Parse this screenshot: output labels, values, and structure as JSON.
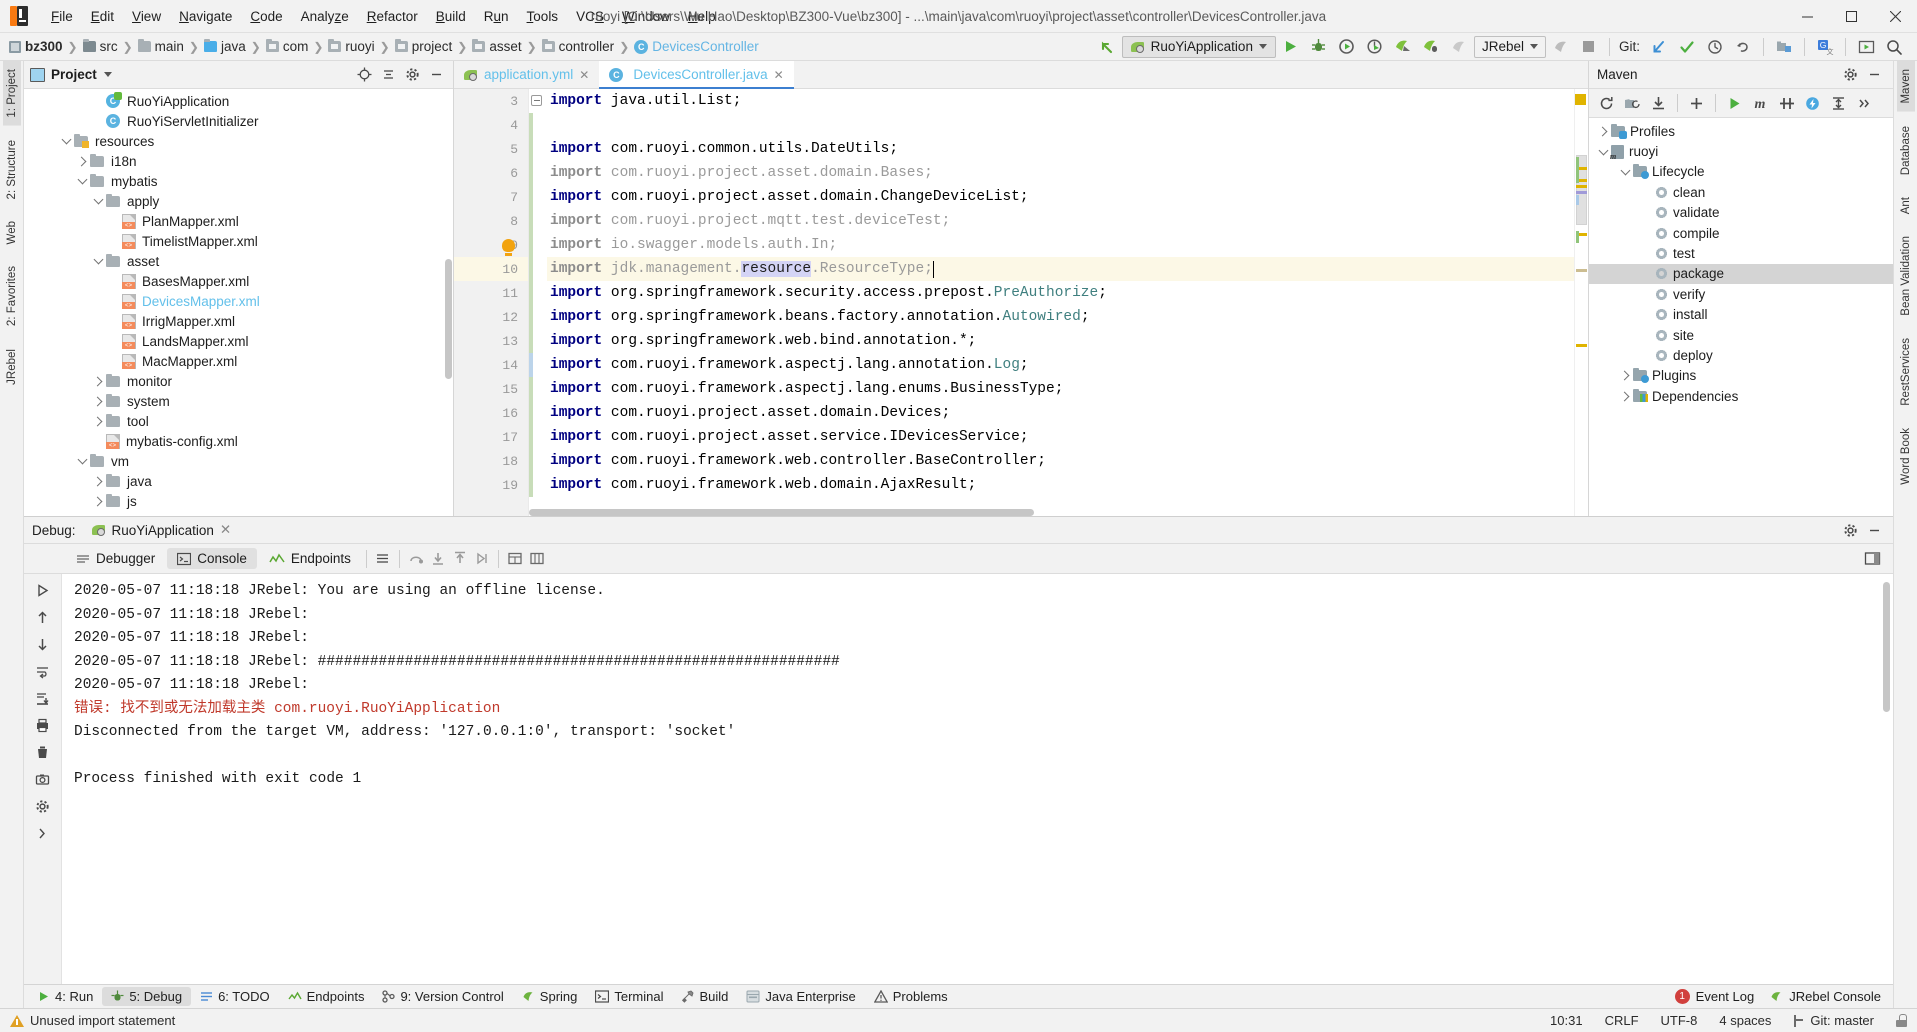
{
  "window": {
    "title": "ruoyi [C:\\Users\\Wu Hao\\Desktop\\BZ300-Vue\\bz300] - ...\\main\\java\\com\\ruoyi\\project\\asset\\controller\\DevicesController.java",
    "minimize": "─",
    "maximize": "☐",
    "close": "✕"
  },
  "menu": [
    "File",
    "Edit",
    "View",
    "Navigate",
    "Code",
    "Analyze",
    "Refactor",
    "Build",
    "Run",
    "Tools",
    "VCS",
    "Window",
    "Help"
  ],
  "breadcrumbs": [
    {
      "label": "bz300",
      "icon": "module-icon",
      "style": "bold"
    },
    {
      "label": "src",
      "icon": "folder-icon",
      "style": "normal"
    },
    {
      "label": "main",
      "icon": "folder-icon",
      "style": "normal"
    },
    {
      "label": "java",
      "icon": "source-folder-icon",
      "style": "normal"
    },
    {
      "label": "com",
      "icon": "package-icon",
      "style": "normal"
    },
    {
      "label": "ruoyi",
      "icon": "package-icon",
      "style": "normal"
    },
    {
      "label": "project",
      "icon": "package-icon",
      "style": "normal"
    },
    {
      "label": "asset",
      "icon": "package-icon",
      "style": "normal"
    },
    {
      "label": "controller",
      "icon": "package-icon",
      "style": "normal"
    },
    {
      "label": "DevicesController",
      "icon": "class-icon",
      "style": "blue"
    }
  ],
  "toolbar": {
    "run_config": "RuoYiApplication",
    "jrebel_config": "JRebel",
    "git_label": "Git:",
    "buttons": [
      "run-button",
      "debug-button",
      "run-with-coverage-button",
      "profile-button",
      "jrebel-run-button",
      "jrebel-debug-button",
      "jrebel-run-disabled-button",
      "jrebel-extra-button",
      "stop-button"
    ],
    "git_buttons": [
      "update-project-button",
      "commit-button",
      "history-button",
      "rollback-button"
    ],
    "right_buttons": [
      "project-structure-button",
      "translate-button",
      "present-mode-button",
      "search-everywhere-button"
    ]
  },
  "project_panel": {
    "title": "Project",
    "header_buttons": [
      "locate-button",
      "collapse-all-button",
      "settings-button",
      "hide-button"
    ],
    "tree": [
      {
        "label": "RuoYiApplication",
        "indent": 5,
        "icon": "runnable-class-icon",
        "arrow": "none",
        "style": "normal"
      },
      {
        "label": "RuoYiServletInitializer",
        "indent": 5,
        "icon": "class-icon",
        "arrow": "none",
        "style": "normal"
      },
      {
        "label": "resources",
        "indent": 3,
        "icon": "resource-folder-icon",
        "arrow": "down",
        "style": "normal"
      },
      {
        "label": "i18n",
        "indent": 4,
        "icon": "folder-icon",
        "arrow": "right",
        "style": "normal"
      },
      {
        "label": "mybatis",
        "indent": 4,
        "icon": "folder-icon",
        "arrow": "down",
        "style": "normal"
      },
      {
        "label": "apply",
        "indent": 5,
        "icon": "folder-icon",
        "arrow": "down",
        "style": "normal"
      },
      {
        "label": "PlanMapper.xml",
        "indent": 6,
        "icon": "xml-file-icon",
        "arrow": "none",
        "style": "normal"
      },
      {
        "label": "TimelistMapper.xml",
        "indent": 6,
        "icon": "xml-file-icon",
        "arrow": "none",
        "style": "normal"
      },
      {
        "label": "asset",
        "indent": 5,
        "icon": "folder-icon",
        "arrow": "down",
        "style": "normal"
      },
      {
        "label": "BasesMapper.xml",
        "indent": 6,
        "icon": "xml-file-icon",
        "arrow": "none",
        "style": "normal"
      },
      {
        "label": "DevicesMapper.xml",
        "indent": 6,
        "icon": "xml-file-icon",
        "arrow": "none",
        "style": "blue"
      },
      {
        "label": "IrrigMapper.xml",
        "indent": 6,
        "icon": "xml-file-icon",
        "arrow": "none",
        "style": "normal"
      },
      {
        "label": "LandsMapper.xml",
        "indent": 6,
        "icon": "xml-file-icon",
        "arrow": "none",
        "style": "normal"
      },
      {
        "label": "MacMapper.xml",
        "indent": 6,
        "icon": "xml-file-icon",
        "arrow": "none",
        "style": "normal"
      },
      {
        "label": "monitor",
        "indent": 5,
        "icon": "folder-icon",
        "arrow": "right",
        "style": "normal"
      },
      {
        "label": "system",
        "indent": 5,
        "icon": "folder-icon",
        "arrow": "right",
        "style": "normal"
      },
      {
        "label": "tool",
        "indent": 5,
        "icon": "folder-icon",
        "arrow": "right",
        "style": "normal"
      },
      {
        "label": "mybatis-config.xml",
        "indent": 5,
        "icon": "xml-file-icon",
        "arrow": "none",
        "style": "normal"
      },
      {
        "label": "vm",
        "indent": 4,
        "icon": "folder-icon",
        "arrow": "down",
        "style": "normal"
      },
      {
        "label": "java",
        "indent": 5,
        "icon": "folder-icon",
        "arrow": "right",
        "style": "normal"
      },
      {
        "label": "js",
        "indent": 5,
        "icon": "folder-icon",
        "arrow": "right",
        "style": "normal"
      }
    ]
  },
  "editor": {
    "tabs": [
      {
        "label": "application.yml",
        "icon": "yml-file-icon",
        "active": false
      },
      {
        "label": "DevicesController.java",
        "icon": "class-icon",
        "active": true
      }
    ],
    "first_line_number": 3,
    "current_line": 10,
    "lines": [
      {
        "num": 3,
        "segments": [
          {
            "t": "import ",
            "c": "kw"
          },
          {
            "t": "java.util.List;",
            "c": "id"
          }
        ]
      },
      {
        "num": 4,
        "segments": []
      },
      {
        "num": 5,
        "segments": [
          {
            "t": "import ",
            "c": "kw"
          },
          {
            "t": "com.ruoyi.common.utils.DateUtils;",
            "c": "id"
          }
        ]
      },
      {
        "num": 6,
        "segments": [
          {
            "t": "import ",
            "c": "kwg"
          },
          {
            "t": "com.ruoyi.project.asset.domain.Bases;",
            "c": "dim"
          }
        ]
      },
      {
        "num": 7,
        "segments": [
          {
            "t": "import ",
            "c": "kw"
          },
          {
            "t": "com.ruoyi.project.asset.domain.ChangeDeviceList;",
            "c": "id"
          }
        ]
      },
      {
        "num": 8,
        "segments": [
          {
            "t": "import ",
            "c": "kwg"
          },
          {
            "t": "com.ruoyi.project.mqtt.test.deviceTest;",
            "c": "dim"
          }
        ]
      },
      {
        "num": 9,
        "segments": [
          {
            "t": "import ",
            "c": "kwg"
          },
          {
            "t": "io.swagger.models.auth.In;",
            "c": "dim"
          }
        ]
      },
      {
        "num": 10,
        "segments": [
          {
            "t": "import ",
            "c": "kwg"
          },
          {
            "t": "jdk.management.",
            "c": "dim"
          },
          {
            "t": "resource",
            "c": "sel"
          },
          {
            "t": ".ResourceType;",
            "c": "dim"
          }
        ]
      },
      {
        "num": 11,
        "segments": [
          {
            "t": "import ",
            "c": "kw"
          },
          {
            "t": "org.springframework.security.access.prepost.",
            "c": "id"
          },
          {
            "t": "PreAuthorize",
            "c": "cls"
          },
          {
            "t": ";",
            "c": "id"
          }
        ]
      },
      {
        "num": 12,
        "segments": [
          {
            "t": "import ",
            "c": "kw"
          },
          {
            "t": "org.springframework.beans.factory.annotation.",
            "c": "id"
          },
          {
            "t": "Autowired",
            "c": "cls"
          },
          {
            "t": ";",
            "c": "id"
          }
        ]
      },
      {
        "num": 13,
        "segments": [
          {
            "t": "import ",
            "c": "kw"
          },
          {
            "t": "org.springframework.web.bind.annotation.*;",
            "c": "id"
          }
        ]
      },
      {
        "num": 14,
        "segments": [
          {
            "t": "import ",
            "c": "kw"
          },
          {
            "t": "com.ruoyi.framework.aspectj.lang.annotation.",
            "c": "id"
          },
          {
            "t": "Log",
            "c": "cls"
          },
          {
            "t": ";",
            "c": "id"
          }
        ]
      },
      {
        "num": 15,
        "segments": [
          {
            "t": "import ",
            "c": "kw"
          },
          {
            "t": "com.ruoyi.framework.aspectj.lang.enums.BusinessType;",
            "c": "id"
          }
        ]
      },
      {
        "num": 16,
        "segments": [
          {
            "t": "import ",
            "c": "kw"
          },
          {
            "t": "com.ruoyi.project.asset.domain.Devices;",
            "c": "id"
          }
        ]
      },
      {
        "num": 17,
        "segments": [
          {
            "t": "import ",
            "c": "kw"
          },
          {
            "t": "com.ruoyi.project.asset.service.IDevicesService;",
            "c": "id"
          }
        ]
      },
      {
        "num": 18,
        "segments": [
          {
            "t": "import ",
            "c": "kw"
          },
          {
            "t": "com.ruoyi.framework.web.controller.BaseController;",
            "c": "id"
          }
        ]
      },
      {
        "num": 19,
        "segments": [
          {
            "t": "import ",
            "c": "kw"
          },
          {
            "t": "com.ruoyi.framework.web.domain.AjaxResult;",
            "c": "id"
          }
        ]
      }
    ]
  },
  "maven": {
    "title": "Maven",
    "toolbar_buttons": [
      "reload-all-button",
      "generate-sources-button",
      "download-sources-button",
      "add-maven-project-button",
      "run-maven-build-button",
      "execute-goal-button",
      "toggle-skip-tests-button",
      "toggle-offline-button",
      "expand-all-button",
      "more-button"
    ],
    "tree": [
      {
        "label": "Profiles",
        "indent": 0,
        "icon": "profiles-folder-icon",
        "arrow": "right",
        "selected": false
      },
      {
        "label": "ruoyi",
        "indent": 0,
        "icon": "maven-project-icon",
        "arrow": "down",
        "selected": false
      },
      {
        "label": "Lifecycle",
        "indent": 1,
        "icon": "lifecycle-folder-icon",
        "arrow": "down",
        "selected": false
      },
      {
        "label": "clean",
        "indent": 2,
        "icon": "goal-icon",
        "arrow": "none",
        "selected": false
      },
      {
        "label": "validate",
        "indent": 2,
        "icon": "goal-icon",
        "arrow": "none",
        "selected": false
      },
      {
        "label": "compile",
        "indent": 2,
        "icon": "goal-icon",
        "arrow": "none",
        "selected": false
      },
      {
        "label": "test",
        "indent": 2,
        "icon": "goal-icon",
        "arrow": "none",
        "selected": false
      },
      {
        "label": "package",
        "indent": 2,
        "icon": "goal-icon",
        "arrow": "none",
        "selected": true
      },
      {
        "label": "verify",
        "indent": 2,
        "icon": "goal-icon",
        "arrow": "none",
        "selected": false
      },
      {
        "label": "install",
        "indent": 2,
        "icon": "goal-icon",
        "arrow": "none",
        "selected": false
      },
      {
        "label": "site",
        "indent": 2,
        "icon": "goal-icon",
        "arrow": "none",
        "selected": false
      },
      {
        "label": "deploy",
        "indent": 2,
        "icon": "goal-icon",
        "arrow": "none",
        "selected": false
      },
      {
        "label": "Plugins",
        "indent": 1,
        "icon": "plugins-folder-icon",
        "arrow": "right",
        "selected": false
      },
      {
        "label": "Dependencies",
        "indent": 1,
        "icon": "dependencies-folder-icon",
        "arrow": "right",
        "selected": false
      }
    ]
  },
  "debug": {
    "label": "Debug:",
    "config_name": "RuoYiApplication",
    "close_tab": "✕",
    "tabs": [
      {
        "label": "Debugger",
        "icon": "debugger-icon",
        "active": false
      },
      {
        "label": "Console",
        "icon": "console-icon",
        "active": true
      },
      {
        "label": "Endpoints",
        "icon": "endpoints-icon",
        "active": false
      }
    ],
    "toolbar_buttons": [
      "layout-button",
      "up-stack-button",
      "down-stack-button",
      "step-out-button",
      "restore-layout-button",
      "soft-wrap-button",
      "scroll-end-button"
    ],
    "side_buttons": [
      "rerun-button",
      "up-button",
      "down-button",
      "stop-button",
      "soft-wrap-button",
      "scroll-to-end-button",
      "print-button",
      "clear-all-button",
      "camera-button",
      "settings-button",
      "more-button"
    ],
    "console_lines": [
      {
        "text": "2020-05-07 11:18:18 JRebel:  You are using an offline license.",
        "error": false
      },
      {
        "text": "2020-05-07 11:18:18 JRebel:",
        "error": false
      },
      {
        "text": "2020-05-07 11:18:18 JRebel:",
        "error": false
      },
      {
        "text": "2020-05-07 11:18:18 JRebel:  ############################################################",
        "error": false
      },
      {
        "text": "2020-05-07 11:18:18 JRebel:",
        "error": false
      },
      {
        "text": "错误: 找不到或无法加载主类 com.ruoyi.RuoYiApplication",
        "error": true
      },
      {
        "text": "Disconnected from the target VM, address: '127.0.0.1:0', transport: 'socket'",
        "error": false
      },
      {
        "text": "",
        "error": false
      },
      {
        "text": "Process finished with exit code 1",
        "error": false
      }
    ]
  },
  "left_strips": [
    {
      "label": "1: Project",
      "active": true
    },
    {
      "label": "2: Structure",
      "active": false
    },
    {
      "label": "Web",
      "active": false
    },
    {
      "label": "2: Favorites",
      "active": false
    },
    {
      "label": "JRebel",
      "active": false
    }
  ],
  "right_strips": [
    {
      "label": "Maven",
      "active": true
    },
    {
      "label": "Database",
      "active": false
    },
    {
      "label": "Ant",
      "active": false
    },
    {
      "label": "Bean Validation",
      "active": false
    },
    {
      "label": "RestServices",
      "active": false
    },
    {
      "label": "Word Book",
      "active": false
    }
  ],
  "toolwindow_bar": {
    "items": [
      {
        "label": "4: Run",
        "icon": "run-icon",
        "active": false
      },
      {
        "label": "5: Debug",
        "icon": "debug-icon",
        "active": true
      },
      {
        "label": "6: TODO",
        "icon": "todo-icon",
        "active": false
      },
      {
        "label": "Endpoints",
        "icon": "endpoints-icon",
        "active": false
      },
      {
        "label": "9: Version Control",
        "icon": "vcs-icon",
        "active": false
      },
      {
        "label": "Spring",
        "icon": "spring-icon",
        "active": false
      },
      {
        "label": "Terminal",
        "icon": "terminal-icon",
        "active": false
      },
      {
        "label": "Build",
        "icon": "build-icon",
        "active": false
      },
      {
        "label": "Java Enterprise",
        "icon": "java-ee-icon",
        "active": false
      },
      {
        "label": "Problems",
        "icon": "problems-icon",
        "active": false
      }
    ],
    "event_log": "Event Log",
    "event_count": "1",
    "jrebel_console": "JRebel Console"
  },
  "statusbar": {
    "message": "Unused import statement",
    "time": "10:31",
    "line_separator": "CRLF",
    "encoding": "UTF-8",
    "indent": "4 spaces",
    "branch": "Git: master"
  },
  "colors": {
    "accent": "#3c7fd0",
    "link_blue": "#63c0ea",
    "error_red": "#c0392b",
    "highlight_yellow": "#fcf8e6",
    "selection": "#d4d4f5"
  }
}
